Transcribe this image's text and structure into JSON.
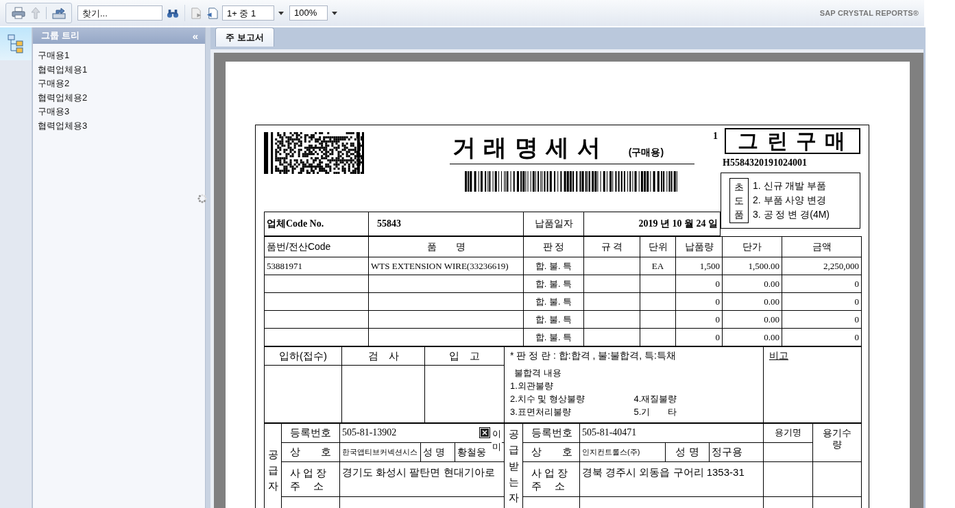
{
  "toolbar": {
    "search": {
      "placeholder": "찾기..."
    },
    "page": "1+ 중 1",
    "zoom": "100%",
    "brand": "SAP CRYSTAL REPORTS®"
  },
  "group_tree": {
    "title": "그룹 트리",
    "collapse": "«",
    "items": [
      {
        "label": "구매용1"
      },
      {
        "label": "협력업체용1"
      },
      {
        "label": "구매용2"
      },
      {
        "label": "협력업체용2"
      },
      {
        "label": "구매용3"
      },
      {
        "label": "협력업체용3"
      }
    ]
  },
  "tabs": [
    {
      "label": "주 보고서",
      "selected": true
    }
  ],
  "report": {
    "page_number": "1",
    "title": "거 래 명 세 서",
    "subtitle": "(구매용)",
    "company": "그 린 구 매",
    "doc_no": "H5584320191024001",
    "first_article": {
      "label": "초도품",
      "items": [
        "1. 신규 개발 부품",
        "2. 부품 사양 변경",
        "3. 공 정 변 경(4M)"
      ]
    },
    "vendor_label": "업체Code No.",
    "vendor_code": "55843",
    "date_label": "납품일자",
    "date": "2019 년 10 월 24 일",
    "columns": [
      "품번/전산Code",
      "품　　명",
      "판 정",
      "규 격",
      "단위",
      "납품량",
      "단가",
      "금액"
    ],
    "rows": [
      {
        "part_no": "53881971",
        "name": "WTS EXTENSION WIRE(33236619)",
        "judgement": "합. 불. 특",
        "unit": "EA",
        "qty": "1,500",
        "price": "1,500.00",
        "amount": "2,250,000"
      },
      {
        "judgement": "합. 불. 특",
        "qty": "0",
        "price": "0.00",
        "amount": "0"
      },
      {
        "judgement": "합. 불. 특",
        "qty": "0",
        "price": "0.00",
        "amount": "0"
      },
      {
        "judgement": "합. 불. 특",
        "qty": "0",
        "price": "0.00",
        "amount": "0"
      },
      {
        "judgement": "합. 불. 특",
        "qty": "0",
        "price": "0.00",
        "amount": "0"
      }
    ],
    "inspection": {
      "columns": [
        "입하(접수)",
        "검　사",
        "입　고"
      ],
      "note_title": "* 판 정 란 : 합:합격 , 불:불합격, 특:특채",
      "defect_title": "불합격 내용",
      "defect_rows": [
        [
          "1.외관불량"
        ],
        [
          "2.치수 및 형상불량",
          "4.재질불량"
        ],
        [
          "3.표면처리불량",
          "5.기　　타"
        ]
      ],
      "remarks": "비고"
    },
    "supplier": {
      "label": "공급자",
      "reg_label": "등록번호",
      "reg_no": "505-81-13902",
      "name_label": "상　　호",
      "name": "한국앱티브커넥션시스",
      "rep_label": "성 명",
      "rep": "황철웅",
      "addr_label": [
        "사 업 장",
        "주　 소"
      ],
      "address": "경기도 화성시 팔탄면 현대기아로"
    },
    "broken_image_alt": [
      "이",
      "미"
    ],
    "recipient": {
      "label": "공급받는자",
      "reg_label": "등록번호",
      "reg_no": "505-81-40471",
      "name_label": "상　　호",
      "name": "인지컨트롤스(주)",
      "rep_label": "성 명",
      "rep": "정구용",
      "addr_label": [
        "사 업 장",
        "주　 소"
      ],
      "address": "경북 경주시 외동읍 구어리 1353-31"
    },
    "container_columns": [
      "용기명",
      "용기수량"
    ]
  }
}
